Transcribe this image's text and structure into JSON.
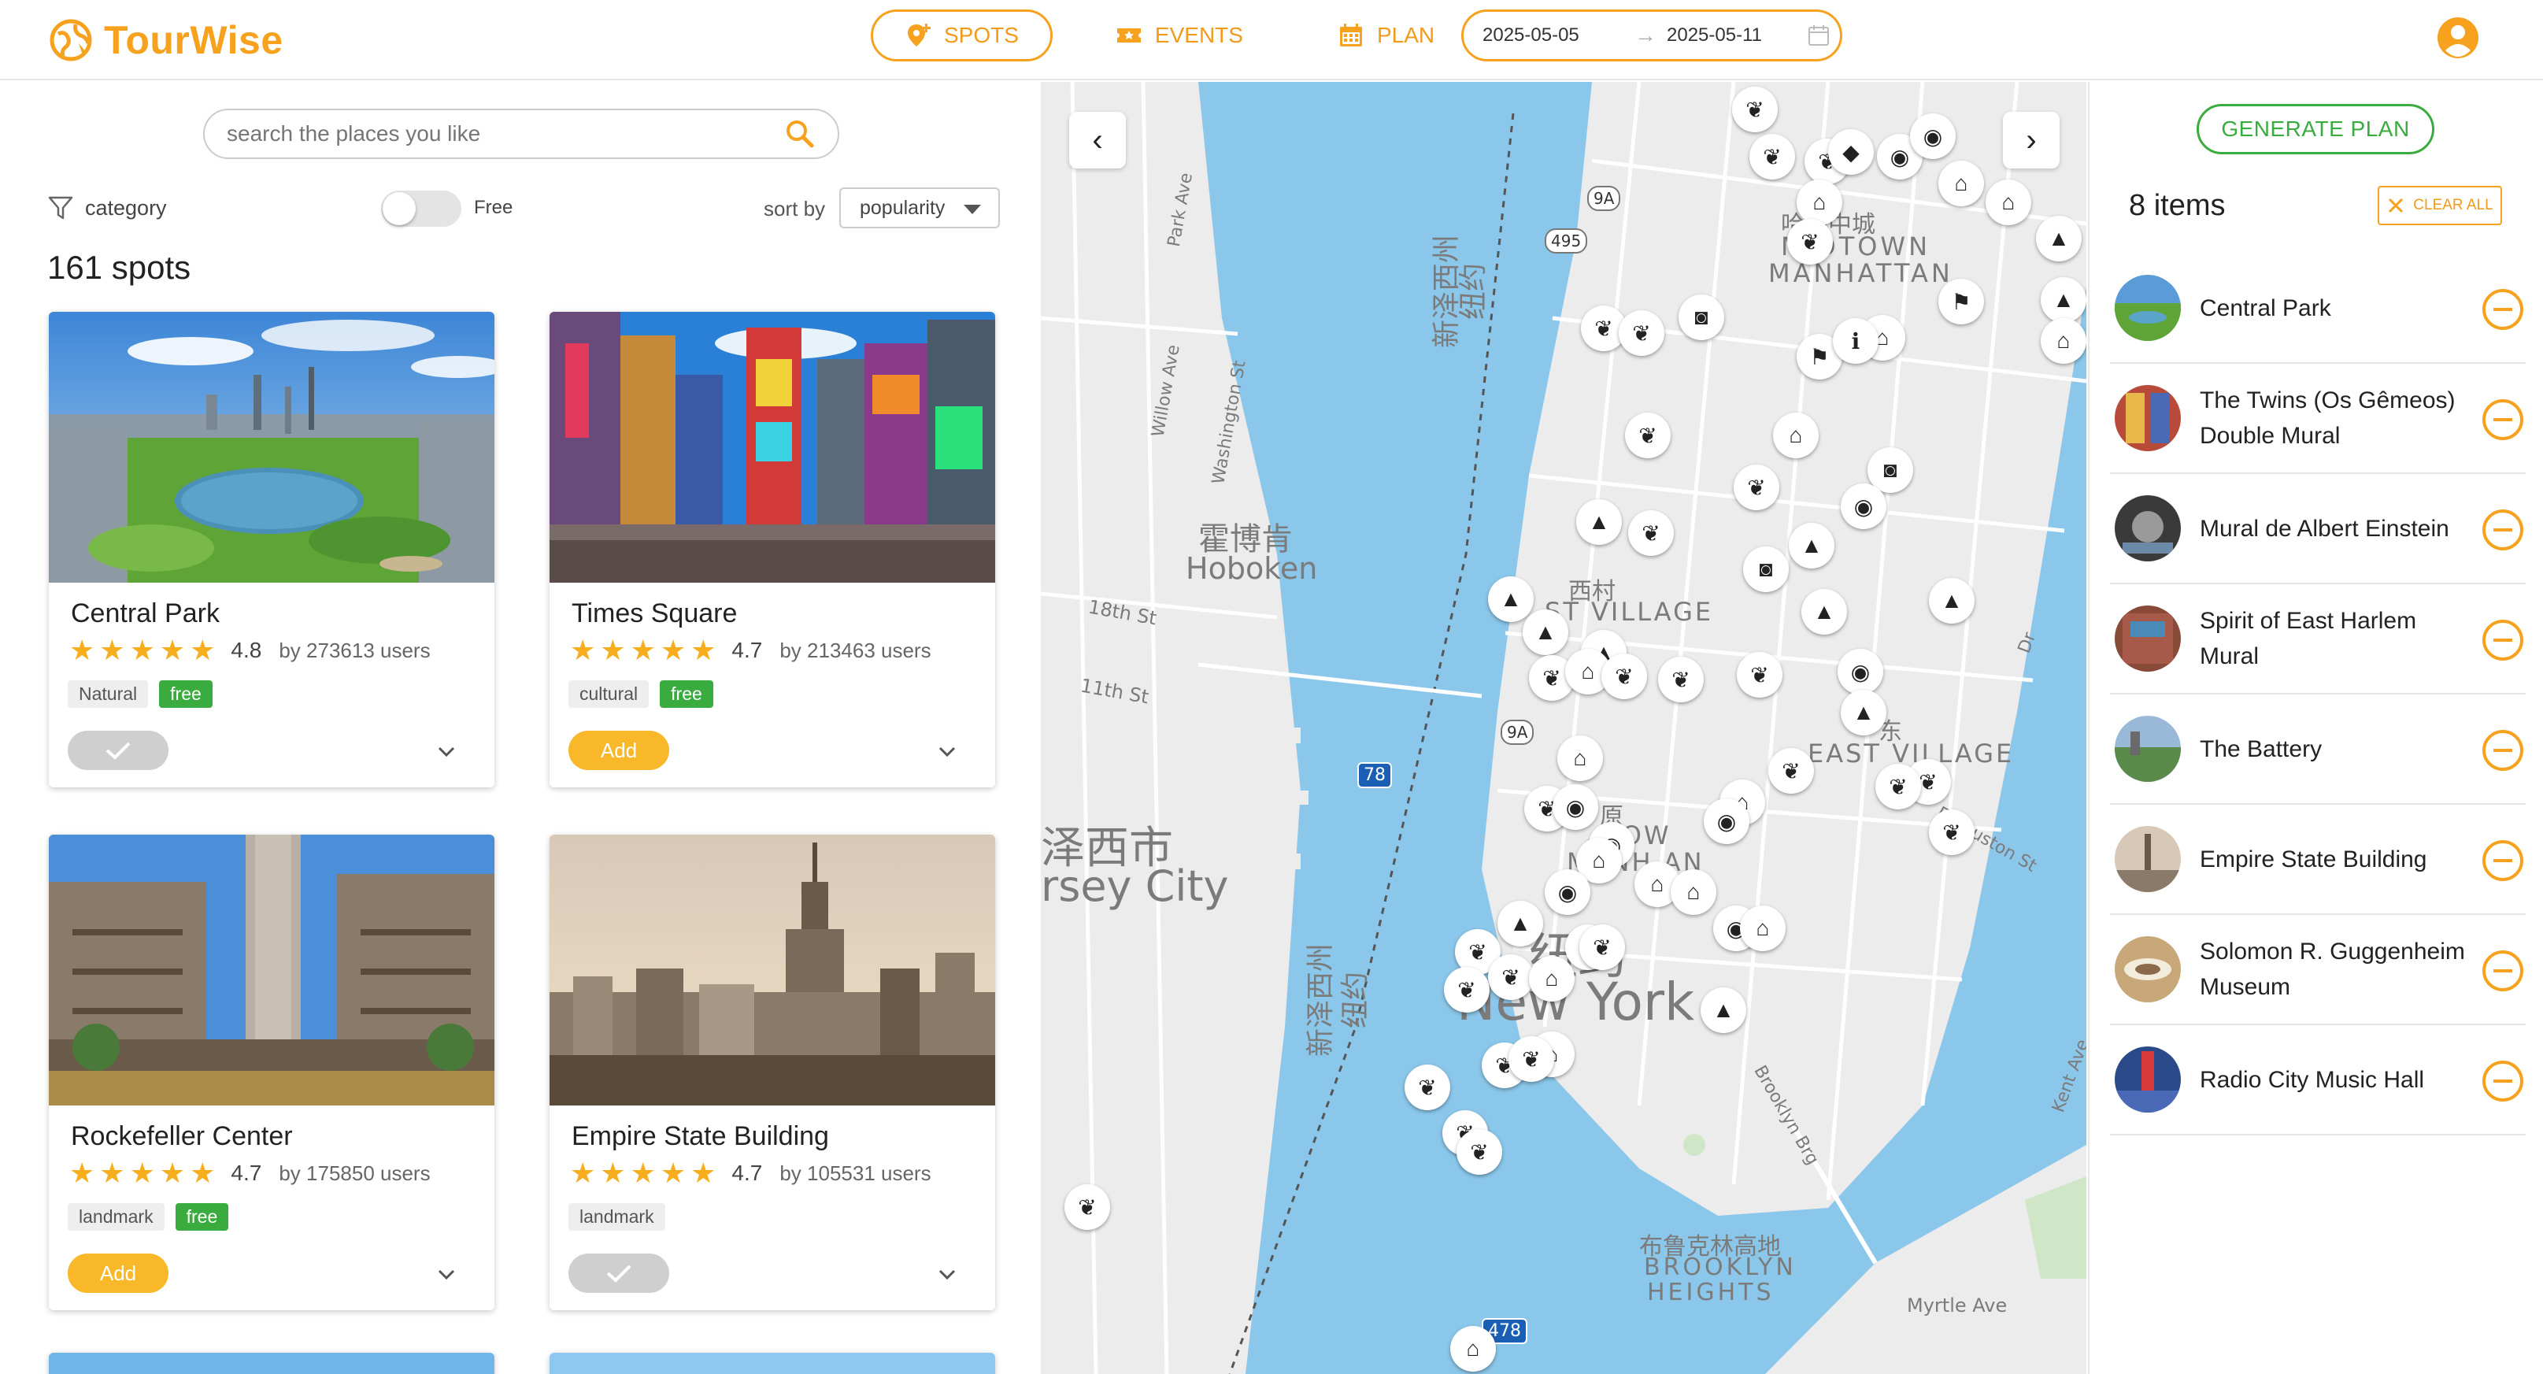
{
  "app": {
    "name": "TourWise",
    "brand_color": "#f6a21e",
    "success_color": "#3aab3e"
  },
  "nav": {
    "items": [
      {
        "label": "SPOTS",
        "icon": "map-pin-plus-icon",
        "active": true
      },
      {
        "label": "EVENTS",
        "icon": "ticket-icon",
        "active": false
      },
      {
        "label": "PLAN",
        "icon": "calendar-icon",
        "active": false
      }
    ],
    "date_start": "2025-05-05",
    "date_arrow": "→",
    "date_end": "2025-05-11"
  },
  "search": {
    "placeholder": "search the places you like"
  },
  "filters": {
    "category_label": "category",
    "free_label": "Free",
    "free_on": false,
    "sortby_label": "sort by",
    "sort_value": "popularity"
  },
  "spots": {
    "count_label": "161 spots",
    "cards": [
      {
        "title": "Central Park",
        "rating": "4.8",
        "users": "by 273613 users",
        "tags": [
          "Natural",
          "free"
        ],
        "added": true,
        "button_label": ""
      },
      {
        "title": "Times Square",
        "rating": "4.7",
        "users": "by 213463 users",
        "tags": [
          "cultural",
          "free"
        ],
        "added": false,
        "button_label": "Add"
      },
      {
        "title": "Rockefeller Center",
        "rating": "4.7",
        "users": "by 175850 users",
        "tags": [
          "landmark",
          "free"
        ],
        "added": false,
        "button_label": "Add"
      },
      {
        "title": "Empire State Building",
        "rating": "4.7",
        "users": "by 105531 users",
        "tags": [
          "landmark"
        ],
        "added": true,
        "button_label": ""
      }
    ],
    "star": "★"
  },
  "map": {
    "prev": "‹",
    "next": "›",
    "labels": {
      "hoboken_cn": "霍博肯",
      "hoboken": "Hoboken",
      "midtown_cn": "哈顿中城",
      "midtown": "MIDTOWN",
      "manhattan": "MANHATTAN",
      "west_village_cn": "西村",
      "west_village": "ST VILLAGE",
      "east_village_cn": "东",
      "east_village": "EAST VILLAGE",
      "lower_cn": "原",
      "lower": "LOW",
      "manhattan2": "MANH   AN",
      "jersey_cn": "泽西市",
      "jersey": "rsey City",
      "newyork_cn": "纽约",
      "newyork": "New York",
      "newjersey_cn": "新泽西州",
      "newjersey_cn2": "纽约",
      "newjersey_cn3": "新泽西州",
      "newjersey_cn4": "纽约",
      "brooklyn_cn": "布鲁克林高地",
      "brooklyn": "BROOKLYN",
      "heights": "HEIGHTS",
      "r9a": "9A",
      "r495": "495",
      "r78": "78",
      "r9a2": "9A",
      "r478": "478",
      "st18": "18th St",
      "st11": "11th St",
      "willow": "Willow Ave",
      "washington": "Washington St",
      "myrtle": "Myrtle Ave",
      "houston": "E Houston St",
      "brooklynbr": "Brooklyn Brg",
      "dr": "Dr",
      "parkave": "Park Ave",
      "kent": "Kent Ave"
    }
  },
  "plan": {
    "generate_label": "GENERATE PLAN",
    "items_label": "8 items",
    "clear_label": "CLEAR ALL",
    "items": [
      {
        "name": "Central Park"
      },
      {
        "name": "The Twins (Os Gêmeos) Double Mural"
      },
      {
        "name": "Mural de Albert Einstein"
      },
      {
        "name": "Spirit of East Harlem Mural"
      },
      {
        "name": "The Battery"
      },
      {
        "name": "Empire State Building"
      },
      {
        "name": "Solomon R. Guggenheim Museum"
      },
      {
        "name": "Radio City Music Hall"
      }
    ]
  }
}
